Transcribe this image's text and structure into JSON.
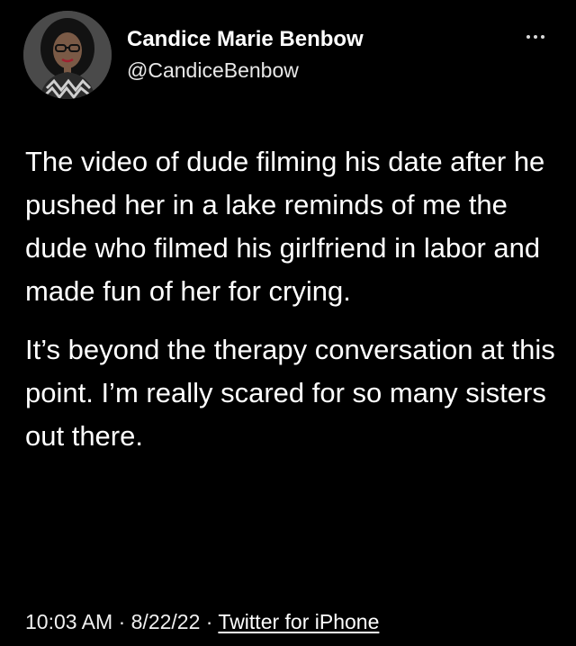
{
  "author": {
    "display_name": "Candice Marie Benbow",
    "handle": "@CandiceBenbow",
    "avatar_icon": "profile-avatar"
  },
  "menu": {
    "icon": "more-horizontal-icon"
  },
  "tweet": {
    "paragraph_1": "The video of dude filming his date after he pushed her in a lake reminds of me the dude who filmed his girlfriend in labor and made fun of her for crying.",
    "paragraph_2": "It’s beyond the therapy conversation at this point. I’m really scared for so many sisters out there."
  },
  "meta": {
    "time": "10:03 AM",
    "separator": " · ",
    "date": "8/22/22",
    "separator_2": " · ",
    "source": "Twitter for iPhone"
  },
  "colors": {
    "background": "#000000",
    "text": "#ffffff",
    "secondary_text": "#e8e8e8"
  }
}
